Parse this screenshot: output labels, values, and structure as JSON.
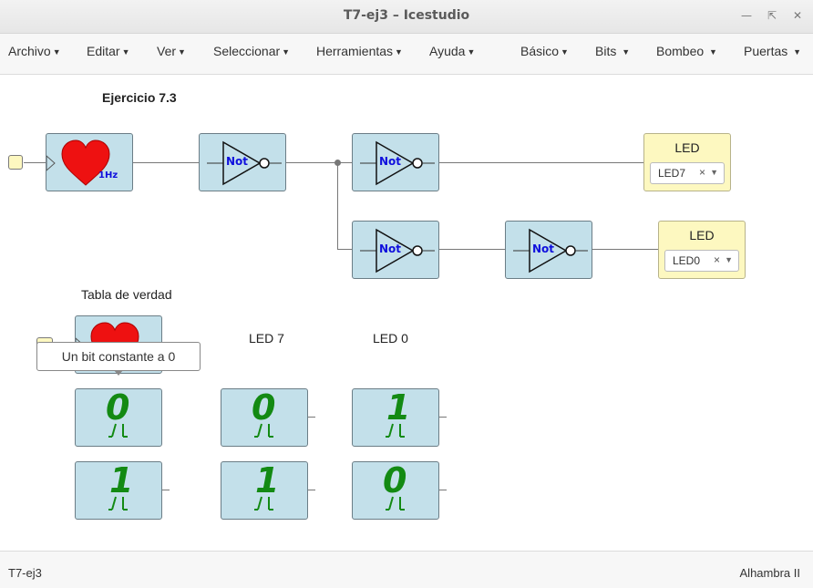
{
  "window": {
    "title": "T7-ej3 – Icestudio"
  },
  "menubar": {
    "left": [
      "Archivo",
      "Editar",
      "Ver",
      "Seleccionar",
      "Herramientas",
      "Ayuda"
    ],
    "right": [
      "Básico",
      "Bits",
      "Bombeo",
      "Puertas"
    ]
  },
  "canvas": {
    "title": "Ejercicio 7.3",
    "heart_freq": "1Hz",
    "not_label": "Not",
    "leds": [
      {
        "title": "LED",
        "value": "LED7"
      },
      {
        "title": "LED",
        "value": "LED0"
      }
    ],
    "truth_table": {
      "title": "Tabla de verdad",
      "col_led7": "LED 7",
      "col_led0": "LED 0",
      "rows": [
        {
          "clk": "0",
          "led7": "0",
          "led0": "1"
        },
        {
          "clk": "1",
          "led7": "1",
          "led0": "0"
        }
      ]
    },
    "tooltip": "Un bit constante a 0"
  },
  "statusbar": {
    "left": "T7-ej3",
    "right": "Alhambra II"
  },
  "colors": {
    "block_bg": "#c3e0ea",
    "led_bg": "#fdf8c0",
    "bit_green": "#138a13",
    "heart_red": "#ee1111",
    "not_text": "#1010dd"
  }
}
